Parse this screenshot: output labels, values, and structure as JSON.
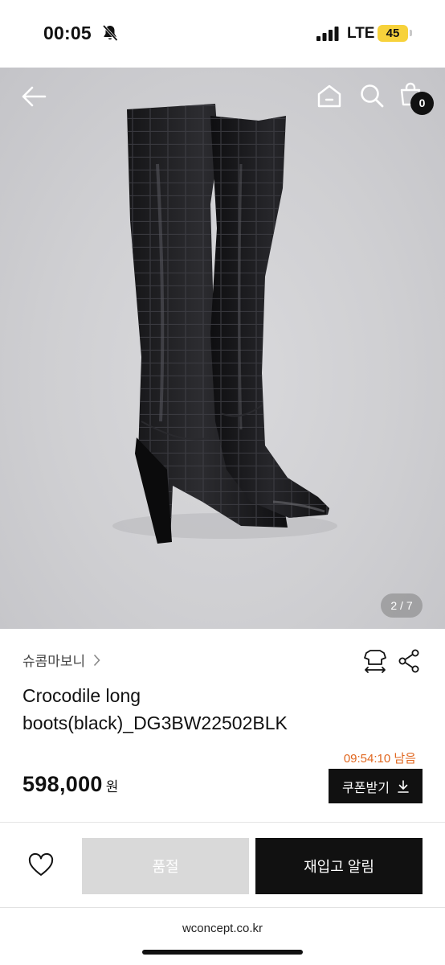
{
  "status_bar": {
    "time": "00:05",
    "network": "LTE",
    "battery": "45",
    "icons": [
      "bell-slash-icon",
      "signal-icon"
    ]
  },
  "hero": {
    "image_subject": "black croc-embossed knee-high western boots",
    "page_current": "2",
    "page_separator": " / ",
    "page_total": "7",
    "cart_count": "0",
    "icons": [
      "back-arrow-icon",
      "home-icon",
      "search-icon",
      "shopping-bag-icon"
    ]
  },
  "product": {
    "brand": "슈콤마보니",
    "title": "Crocodile long boots(black)_DG3BW22502BLK",
    "timer": "09:54:10 남음",
    "price": "598,000",
    "price_unit": "원",
    "coupon_label": "쿠폰받기",
    "icons": [
      "size-guide-icon",
      "share-icon",
      "download-icon",
      "chevron-right-icon"
    ]
  },
  "actions": {
    "soldout_label": "품절",
    "restock_label": "재입고 알림",
    "icons": [
      "heart-icon"
    ]
  },
  "browser": {
    "url": "wconcept.co.kr"
  },
  "colors": {
    "accent_timer": "#e0661e",
    "primary_button": "#111111",
    "disabled_button": "#d9d9d9",
    "battery": "#f7d23b"
  }
}
